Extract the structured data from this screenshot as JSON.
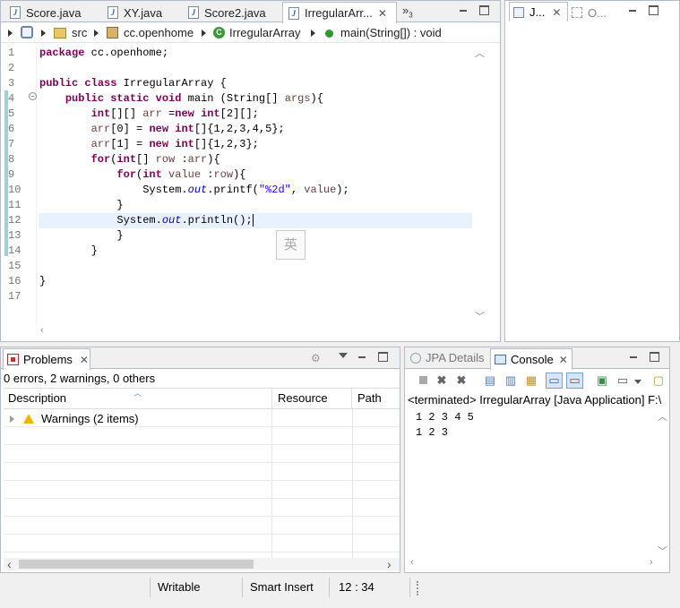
{
  "editor": {
    "tabs": [
      {
        "label": "Score.java"
      },
      {
        "label": "XY.java"
      },
      {
        "label": "Score2.java"
      },
      {
        "label": "IrregularArr..."
      }
    ],
    "overflow_label": "»",
    "overflow_count": "3",
    "breadcrumb": {
      "src": "src",
      "package": "cc.openhome",
      "class": "IrregularArray",
      "method": "main(String[]) : void"
    },
    "lines": [
      "1",
      "2",
      "3",
      "4",
      "5",
      "6",
      "7",
      "8",
      "9",
      "10",
      "11",
      "12",
      "13",
      "14",
      "15",
      "16",
      "17"
    ],
    "ime_char": "英"
  },
  "outline": {
    "tab1": "J...",
    "tab2": "O..."
  },
  "problems": {
    "tab_label": "Problems",
    "summary": "0 errors, 2 warnings, 0 others",
    "columns": [
      "Description",
      "Resource",
      "Path"
    ],
    "rows": [
      {
        "description": "Warnings (2 items)"
      }
    ]
  },
  "console": {
    "tab_jpa": "JPA Details",
    "tab_console": "Console",
    "header": "<terminated> IrregularArray [Java Application] F:\\",
    "output": [
      "1 2 3 4 5",
      "1 2 3"
    ]
  },
  "status": {
    "writable": "Writable",
    "insert_mode": "Smart Insert",
    "position": "12 : 34"
  },
  "colors": {
    "keyword": "#7f0055",
    "string": "#2a00ff",
    "field": "#0000c0",
    "current_line": "#e8f2fe"
  }
}
